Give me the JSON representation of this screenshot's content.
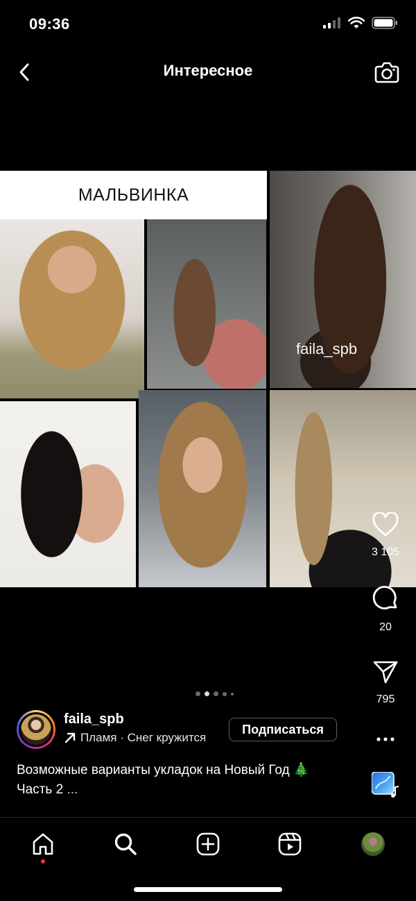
{
  "status_bar": {
    "time": "09:36"
  },
  "header": {
    "title": "Интересное",
    "back_icon": "chevron-left-icon",
    "camera_icon": "camera-icon"
  },
  "post": {
    "collage_title": "МАЛЬВИНКА",
    "watermark": "faila_spb",
    "carousel": {
      "total_dots": 5,
      "active_index": 1
    },
    "likes": "3 105",
    "comments": "20",
    "shares": "795",
    "author": {
      "username": "faila_spb",
      "music_label": "Пламя · Снег кружится",
      "follow_label": "Подписаться"
    },
    "caption": {
      "line1": "Возможные варианты укладок на Новый Год 🎄",
      "line2": "Часть 2",
      "more": " ..."
    }
  },
  "nav": {
    "items": [
      "home-icon",
      "search-icon",
      "create-icon",
      "reels-icon",
      "profile-avatar"
    ]
  },
  "colors": {
    "background": "#000000",
    "notification_dot": "#ff3040",
    "follow_border": "#5c5c5c"
  }
}
